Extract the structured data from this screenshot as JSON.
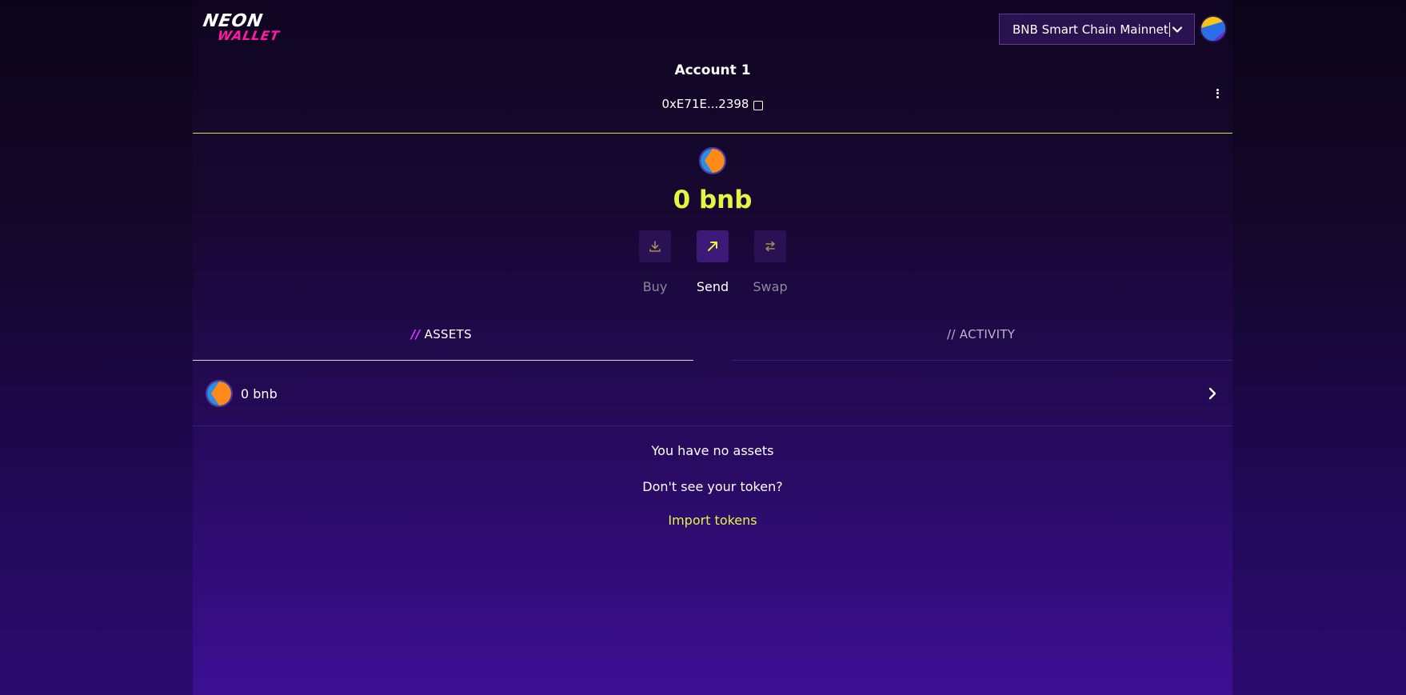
{
  "brand": {
    "logo_top": "NEON",
    "logo_bottom": "WALLET"
  },
  "network": {
    "selected": "BNB Smart Chain Mainnet"
  },
  "account": {
    "name": "Account 1",
    "address": "0xE71E...2398"
  },
  "balance": {
    "amount": "0 bnb"
  },
  "actions": [
    {
      "label": "Buy",
      "icon": "download-icon"
    },
    {
      "label": "Send",
      "icon": "arrow-up-right-icon"
    },
    {
      "label": "Swap",
      "icon": "swap-icon"
    }
  ],
  "tabs": [
    {
      "label": "ASSETS",
      "prefix": "//"
    },
    {
      "label": "ACTIVITY",
      "prefix": "//"
    }
  ],
  "assets": [
    {
      "label": "0 bnb"
    }
  ],
  "empty": {
    "message": "You have no assets",
    "question": "Don't see your token?",
    "import_label": "Import tokens"
  },
  "colors": {
    "accent": "#e6f542",
    "brand_pink": "#ff1aa5",
    "tab_slash": "#e23cff"
  }
}
